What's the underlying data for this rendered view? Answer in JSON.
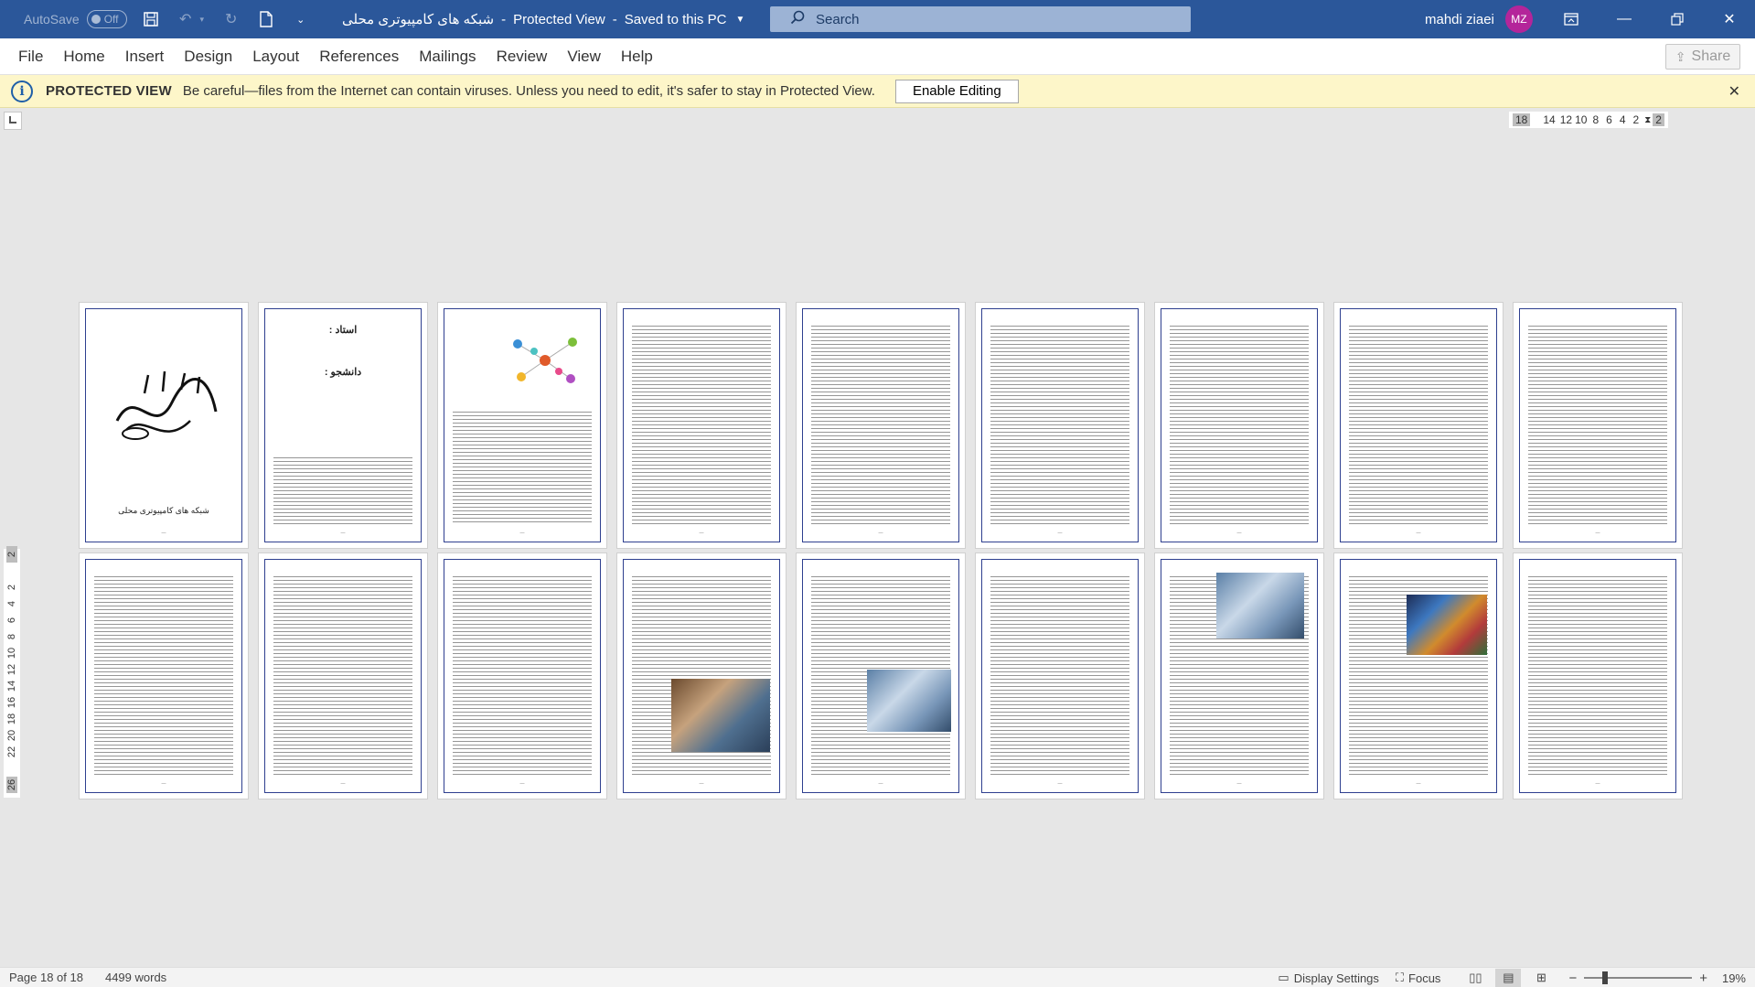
{
  "titlebar": {
    "autosave_label": "AutoSave",
    "autosave_state": "Off",
    "document_name": "شبکه های کامپیوتری محلی",
    "separator": "-",
    "view_mode": "Protected View",
    "save_state": "Saved to this PC",
    "search_placeholder": "Search",
    "user_name": "mahdi ziaei",
    "user_initials": "MZ"
  },
  "ribbon": {
    "tabs": [
      "File",
      "Home",
      "Insert",
      "Design",
      "Layout",
      "References",
      "Mailings",
      "Review",
      "View",
      "Help"
    ],
    "share_label": "Share"
  },
  "protected_view": {
    "title": "PROTECTED VIEW",
    "message": "Be careful—files from the Internet can contain viruses. Unless you need to edit, it's safer to stay in Protected View.",
    "enable_label": "Enable Editing"
  },
  "ruler": {
    "horizontal_ticks": [
      "18",
      "14",
      "12",
      "10",
      "8",
      "6",
      "4",
      "2",
      "2"
    ],
    "vertical_ticks": [
      "2",
      "2",
      "4",
      "6",
      "8",
      "10",
      "12",
      "14",
      "16",
      "18",
      "20",
      "22",
      "26"
    ]
  },
  "pages": {
    "cover_caption": "شبکه های کامپیوتری محلی",
    "professor_label": "استاد :",
    "student_label": "دانشجو :",
    "count": 18
  },
  "statusbar": {
    "page_info": "Page 18 of 18",
    "word_count": "4499 words",
    "display_settings": "Display Settings",
    "focus": "Focus",
    "zoom_minus": "−",
    "zoom_plus": "+",
    "zoom_level": "19%"
  },
  "colors": {
    "titlebar_bg": "#2b579a",
    "protected_bg": "#fdf6c9",
    "page_border": "#2e3f8f",
    "avatar_bg": "#b4259a"
  }
}
